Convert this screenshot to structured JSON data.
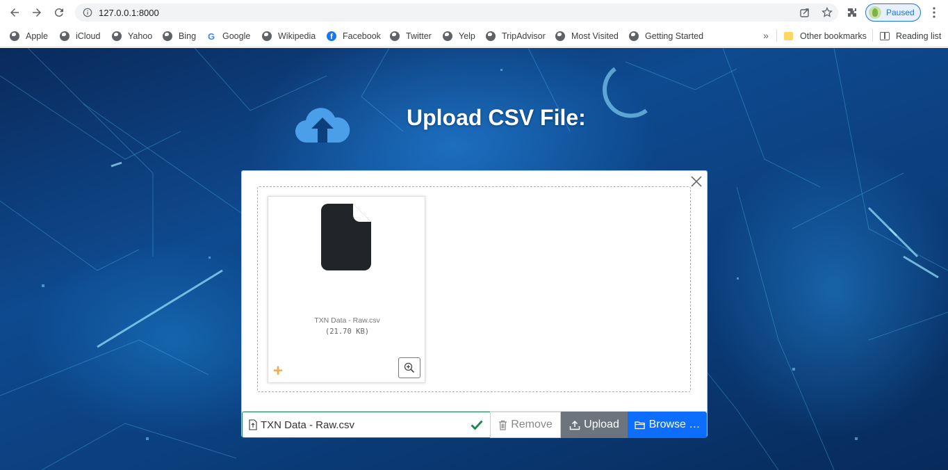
{
  "browser": {
    "url": "127.0.0.1:8000",
    "profile_status": "Paused",
    "bookmarks": [
      {
        "label": "Apple",
        "icon": "globe-icon"
      },
      {
        "label": "iCloud",
        "icon": "globe-icon"
      },
      {
        "label": "Yahoo",
        "icon": "globe-icon"
      },
      {
        "label": "Bing",
        "icon": "globe-icon"
      },
      {
        "label": "Google",
        "icon": "google-icon"
      },
      {
        "label": "Wikipedia",
        "icon": "globe-icon"
      },
      {
        "label": "Facebook",
        "icon": "facebook-icon"
      },
      {
        "label": "Twitter",
        "icon": "globe-icon"
      },
      {
        "label": "Yelp",
        "icon": "globe-icon"
      },
      {
        "label": "TripAdvisor",
        "icon": "globe-icon"
      },
      {
        "label": "Most Visited",
        "icon": "globe-icon"
      },
      {
        "label": "Getting Started",
        "icon": "globe-icon"
      }
    ],
    "other_bookmarks": "Other bookmarks",
    "reading_list": "Reading list",
    "overflow": "»"
  },
  "page": {
    "title": "Upload CSV File:"
  },
  "upload": {
    "file_name": "TXN Data - Raw.csv",
    "file_size": "(21.70 KB)",
    "caption_name": "TXN Data - Raw.csv",
    "remove_label": "Remove",
    "upload_label": "Upload",
    "browse_label": "Browse …"
  },
  "colors": {
    "success": "#198754",
    "upload_btn": "#6c757d",
    "browse_btn": "#0d6efd",
    "add_icon": "#f0ad4e"
  }
}
